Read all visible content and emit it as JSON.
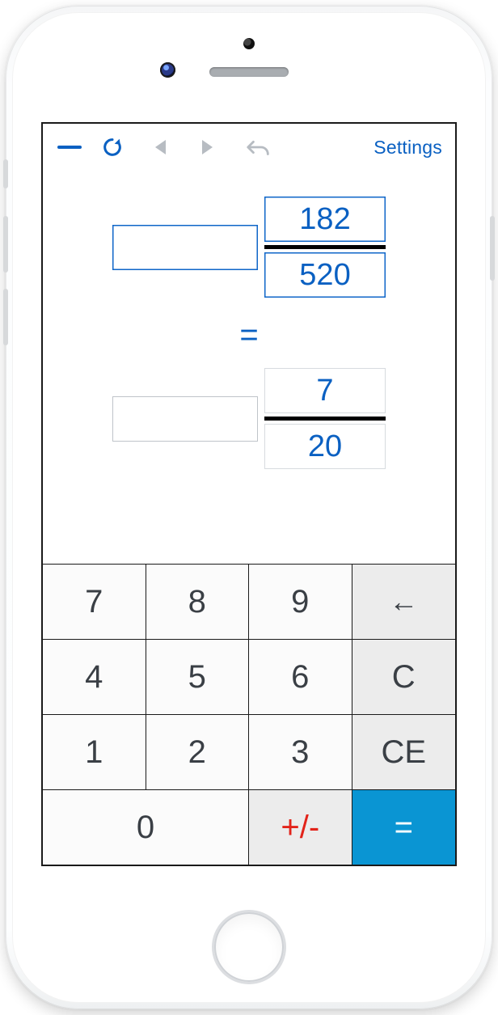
{
  "toolbar": {
    "settings_label": "Settings"
  },
  "fraction": {
    "input": {
      "whole": "",
      "numerator": "182",
      "denominator": "520"
    },
    "equals": "=",
    "result": {
      "whole": "",
      "numerator": "7",
      "denominator": "20"
    }
  },
  "keypad": {
    "k7": "7",
    "k8": "8",
    "k9": "9",
    "back": "←",
    "k4": "4",
    "k5": "5",
    "k6": "6",
    "clear": "C",
    "k1": "1",
    "k2": "2",
    "k3": "3",
    "clear_entry": "CE",
    "k0": "0",
    "plus_minus": "+/-",
    "equals": "="
  },
  "colors": {
    "accent": "#0a60c2",
    "equals_bg": "#0a95d3",
    "pm": "#e2231a"
  }
}
